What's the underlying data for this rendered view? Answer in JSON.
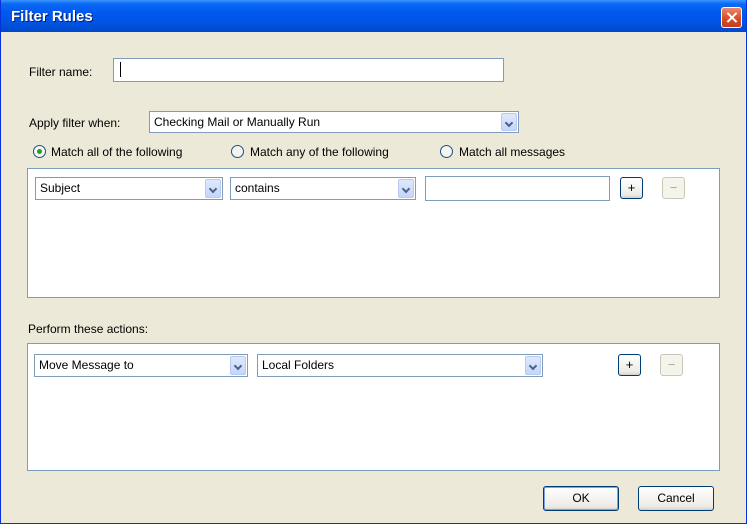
{
  "window": {
    "title": "Filter Rules"
  },
  "filter_name": {
    "label": "Filter name:",
    "value": ""
  },
  "apply_when": {
    "label": "Apply filter when:",
    "selected": "Checking Mail or Manually Run"
  },
  "match": {
    "options": [
      {
        "label": "Match all of the following",
        "checked": true
      },
      {
        "label": "Match any of the following",
        "checked": false
      },
      {
        "label": "Match all messages",
        "checked": false
      }
    ]
  },
  "rule": {
    "field": "Subject",
    "operator": "contains",
    "value": "",
    "add_label": "+",
    "remove_label": "−"
  },
  "actions": {
    "label": "Perform these actions:",
    "action": "Move Message to",
    "target": "Local Folders",
    "add_label": "+",
    "remove_label": "−"
  },
  "footer": {
    "ok_label": "OK",
    "cancel_label": "Cancel"
  },
  "colors": {
    "titlebar": "#0054e3",
    "dialog_bg": "#ece9d8",
    "close_red": "#d9512b"
  }
}
